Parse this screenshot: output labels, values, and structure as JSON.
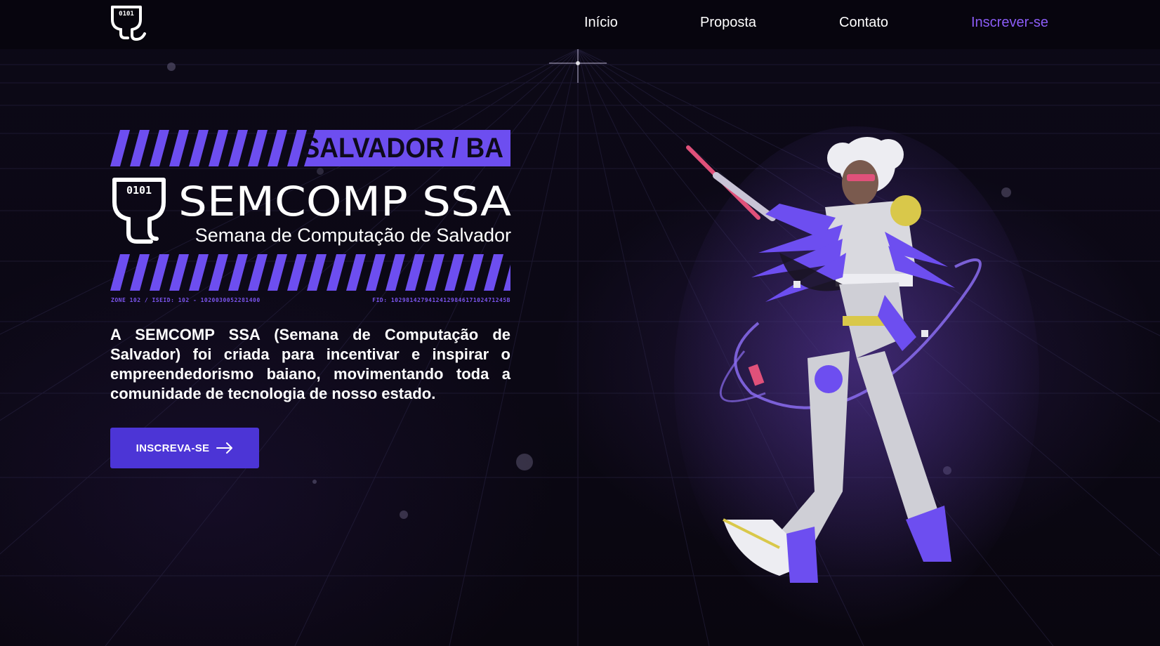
{
  "header": {
    "logo_icon": "lightbulb-brain-icon",
    "nav": [
      {
        "label": "Início",
        "active": false
      },
      {
        "label": "Proposta",
        "active": false
      },
      {
        "label": "Contato",
        "active": false
      },
      {
        "label": "Inscrever-se",
        "active": true
      }
    ]
  },
  "hero": {
    "city": "SALVADOR / BA",
    "title": "SEMCOMP SSA",
    "subtitle": "Semana de Computação de Salvador",
    "micro_left": "ZONE 102 / ISEID: 102 - 1020030052281400",
    "micro_right": "FID: 1029814279412412984617102471245B",
    "description": "A SEMCOMP SSA (Semana de Computação de Salvador) foi criada para incentivar e inspirar o empreendedorismo baiano, movimentando toda a comunidade de tecnologia de nosso estado.",
    "cta_label": "INSCREVA-SE",
    "cta_icon": "arrow-right-icon",
    "illustration": "cyberpunk-character-illustration"
  },
  "colors": {
    "accent": "#8b5cf6",
    "button": "#4c35d6",
    "stripes": "#6d4ef0",
    "background": "#0a0713",
    "header": "#07050e"
  }
}
